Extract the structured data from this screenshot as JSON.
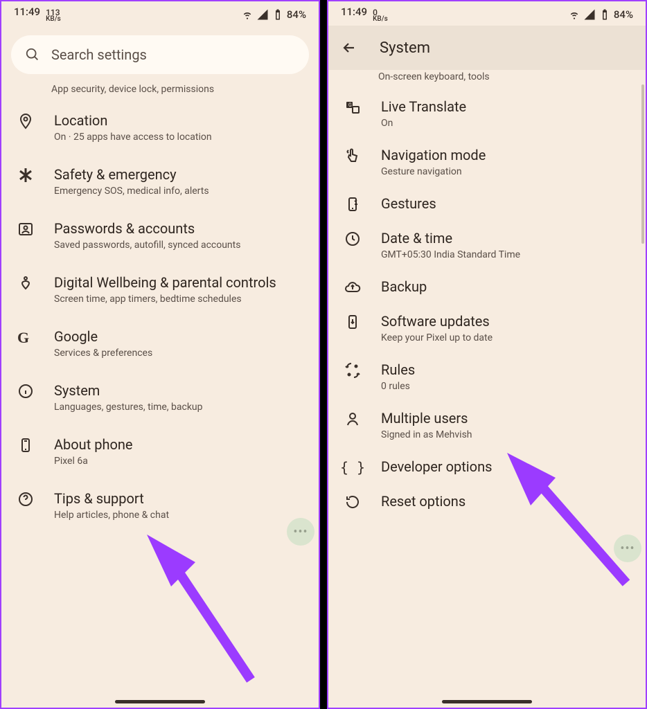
{
  "status": {
    "time": "11:49",
    "net_left_num": "113",
    "net_left_unit": "KB/s",
    "net_right_num": "0",
    "net_right_unit": "KB/s",
    "battery": "84%"
  },
  "left": {
    "search_placeholder": "Search settings",
    "partial_sub": "App security, device lock, permissions",
    "items": [
      {
        "title": "Location",
        "sub": "On · 25 apps have access to location"
      },
      {
        "title": "Safety & emergency",
        "sub": "Emergency SOS, medical info, alerts"
      },
      {
        "title": "Passwords & accounts",
        "sub": "Saved passwords, autofill, synced accounts"
      },
      {
        "title": "Digital Wellbeing & parental controls",
        "sub": "Screen time, app timers, bedtime schedules"
      },
      {
        "title": "Google",
        "sub": "Services & preferences"
      },
      {
        "title": "System",
        "sub": "Languages, gestures, time, backup"
      },
      {
        "title": "About phone",
        "sub": "Pixel 6a"
      },
      {
        "title": "Tips & support",
        "sub": "Help articles, phone & chat"
      }
    ]
  },
  "right": {
    "header": "System",
    "partial_sub": "On-screen keyboard, tools",
    "items": [
      {
        "title": "Live Translate",
        "sub": "On"
      },
      {
        "title": "Navigation mode",
        "sub": "Gesture navigation"
      },
      {
        "title": "Gestures",
        "sub": ""
      },
      {
        "title": "Date & time",
        "sub": "GMT+05:30 India Standard Time"
      },
      {
        "title": "Backup",
        "sub": ""
      },
      {
        "title": "Software updates",
        "sub": "Keep your Pixel up to date"
      },
      {
        "title": "Rules",
        "sub": "0 rules"
      },
      {
        "title": "Multiple users",
        "sub": "Signed in as Mehvish"
      },
      {
        "title": "Developer options",
        "sub": ""
      },
      {
        "title": "Reset options",
        "sub": ""
      }
    ]
  },
  "annotations": {
    "arrow_left_target": "System",
    "arrow_right_target": "Software updates"
  }
}
